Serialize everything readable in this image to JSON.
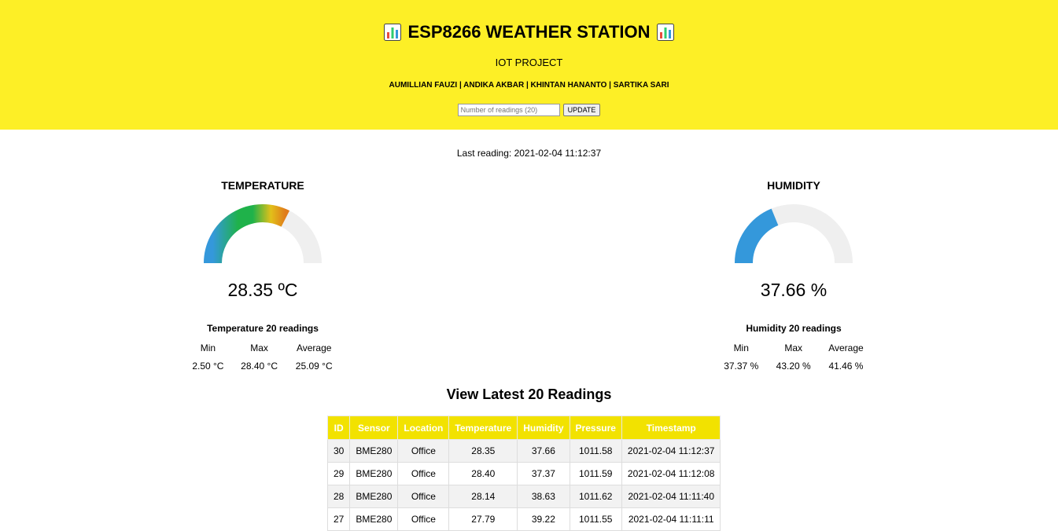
{
  "header": {
    "title": "ESP8266 WEATHER STATION",
    "subtitle": "IOT PROJECT",
    "authors": "AUMILLIAN FAUZI | ANDIKA AKBAR | KHINTAN HANANTO | SARTIKA SARI",
    "readings_placeholder": "Number of readings (20)",
    "update_label": "UPDATE",
    "icon": "bar-chart-icon",
    "background_color": "#fdef26"
  },
  "last_reading": "Last reading: 2021-02-04 11:12:37",
  "temperature": {
    "title": "TEMPERATURE",
    "value_text": "28.35 ºC",
    "gauge_fraction": 0.65,
    "stats_title": "Temperature 20 readings",
    "headers": [
      "Min",
      "Max",
      "Average"
    ],
    "values": [
      "2.50 °C",
      "28.40 °C",
      "25.09 °C"
    ]
  },
  "humidity": {
    "title": "HUMIDITY",
    "value_text": "37.66 %",
    "gauge_fraction": 0.3766,
    "gauge_color": "#3498db",
    "stats_title": "Humidity 20 readings",
    "headers": [
      "Min",
      "Max",
      "Average"
    ],
    "values": [
      "37.37 %",
      "43.20 %",
      "41.46 %"
    ]
  },
  "readings_table": {
    "title": "View Latest 20 Readings",
    "columns": [
      "ID",
      "Sensor",
      "Location",
      "Temperature",
      "Humidity",
      "Pressure",
      "Timestamp"
    ],
    "header_color": "#f2e200",
    "rows": [
      [
        "30",
        "BME280",
        "Office",
        "28.35",
        "37.66",
        "1011.58",
        "2021-02-04 11:12:37"
      ],
      [
        "29",
        "BME280",
        "Office",
        "28.40",
        "37.37",
        "1011.59",
        "2021-02-04 11:12:08"
      ],
      [
        "28",
        "BME280",
        "Office",
        "28.14",
        "38.63",
        "1011.62",
        "2021-02-04 11:11:40"
      ],
      [
        "27",
        "BME280",
        "Office",
        "27.79",
        "39.22",
        "1011.55",
        "2021-02-04 11:11:11"
      ]
    ]
  }
}
